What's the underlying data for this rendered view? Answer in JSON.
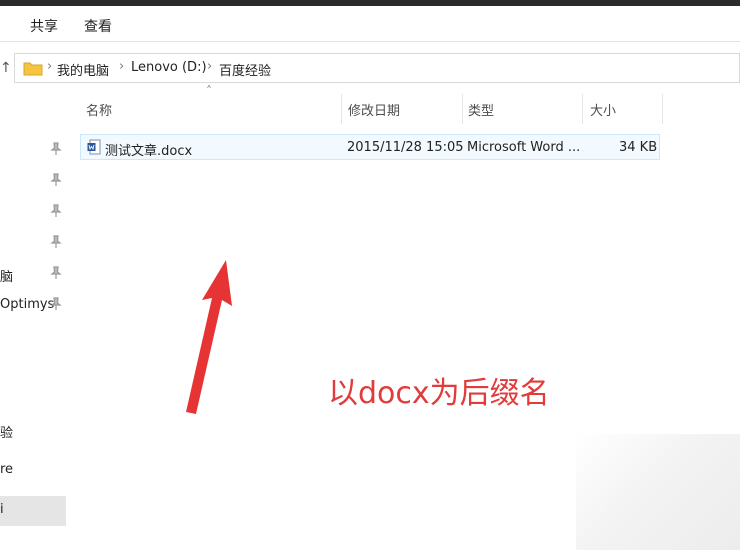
{
  "ribbon": {
    "tabs": [
      "",
      "共享",
      "查看"
    ]
  },
  "address": {
    "path": [
      "我的电脑",
      "Lenovo (D:)",
      "百度经验"
    ],
    "separator": "›",
    "up_glyph": "↑"
  },
  "sidebar": {
    "items": [
      {
        "label": "",
        "pinned": true
      },
      {
        "label": "",
        "pinned": true
      },
      {
        "label": "",
        "pinned": true
      },
      {
        "label": "",
        "pinned": true
      },
      {
        "label": "脑",
        "pinned": true
      },
      {
        "label": "Optimys",
        "pinned": true
      },
      {
        "label": "验",
        "pinned": false
      },
      {
        "label": "re",
        "pinned": false
      },
      {
        "label": "i",
        "pinned": false,
        "selected": true
      }
    ]
  },
  "columns": {
    "name": "名称",
    "modified": "修改日期",
    "type": "类型",
    "size": "大小"
  },
  "files": [
    {
      "name": "测试文章.docx",
      "modified": "2015/11/28 15:05",
      "type": "Microsoft Word ...",
      "size": "34 KB"
    }
  ],
  "annotation": {
    "text": "以docx为后缀名",
    "color": "#e23b3b"
  },
  "colors": {
    "selection_border": "#cce8ff",
    "selection_bg": "#f2f9ff",
    "folder": "#f5c542",
    "word": "#2b579a"
  }
}
